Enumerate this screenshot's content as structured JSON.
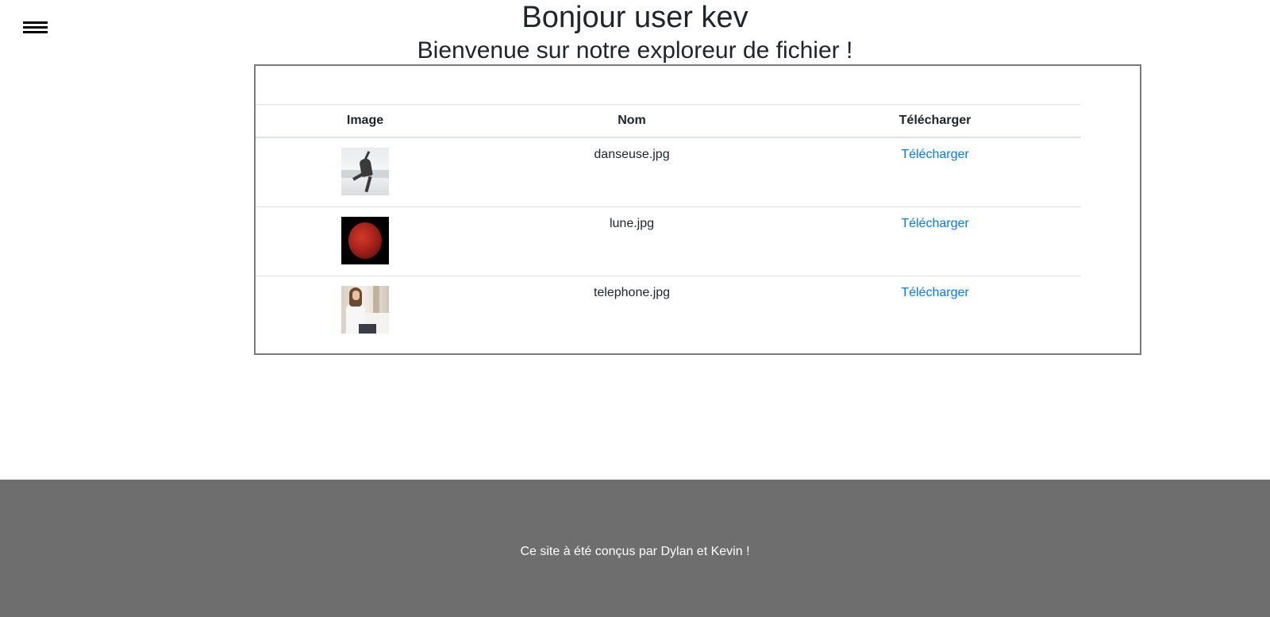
{
  "header": {
    "menu_icon": "hamburger-menu-icon",
    "title": "Bonjour user kev",
    "subtitle": "Bienvenue sur notre exploreur de fichier !"
  },
  "table": {
    "columns": [
      "Image",
      "Nom",
      "Télécharger"
    ],
    "rows": [
      {
        "image": "dancer-photo",
        "name": "danseuse.jpg",
        "download_label": "Télécharger"
      },
      {
        "image": "red-moon-photo",
        "name": "lune.jpg",
        "download_label": "Télécharger"
      },
      {
        "image": "woman-phone-photo",
        "name": "telephone.jpg",
        "download_label": "Télécharger"
      }
    ]
  },
  "footer": {
    "text": "Ce site à été conçus par Dylan et Kevin !",
    "background": "#6e6e6e"
  },
  "colors": {
    "link": "#007bff",
    "text": "#212529"
  }
}
